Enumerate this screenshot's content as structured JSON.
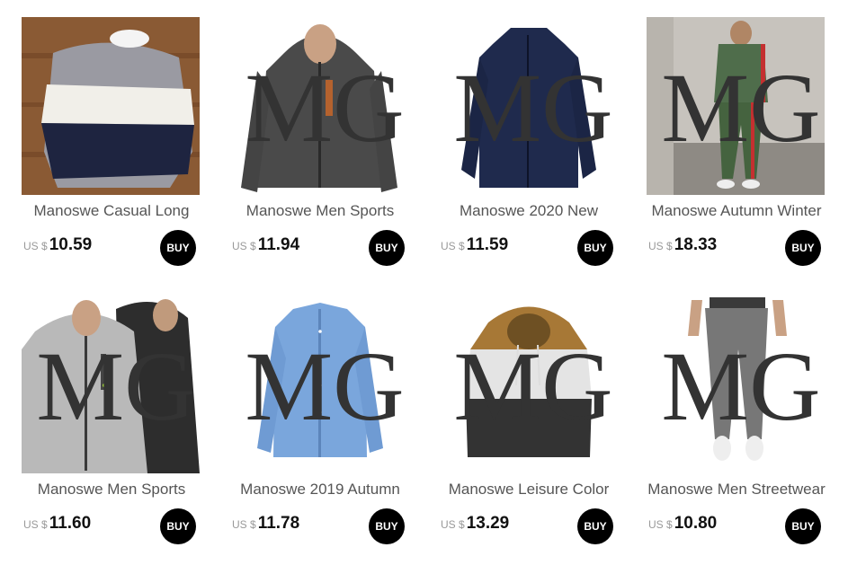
{
  "currency_prefix": "US $",
  "buy_label": "BUY",
  "brand_logo": "MG",
  "products": [
    {
      "title": "Manoswe Casual Long",
      "price": "10.59",
      "image": "striped-sweater-photo"
    },
    {
      "title": "Manoswe Men Sports",
      "price": "11.94",
      "image": "grey-hoodie-photo"
    },
    {
      "title": "Manoswe 2020 New",
      "price": "11.59",
      "image": "navy-jacket-photo"
    },
    {
      "title": "Manoswe Autumn Winter",
      "price": "18.33",
      "image": "green-tracksuit-photo"
    },
    {
      "title": "Manoswe Men Sports",
      "price": "11.60",
      "image": "two-hoodies-photo"
    },
    {
      "title": "Manoswe 2019 Autumn",
      "price": "11.78",
      "image": "blue-shirt-photo"
    },
    {
      "title": "Manoswe Leisure Color",
      "price": "13.29",
      "image": "colorblock-hoodie-photo"
    },
    {
      "title": "Manoswe Men Streetwear",
      "price": "10.80",
      "image": "grey-joggers-photo"
    }
  ]
}
